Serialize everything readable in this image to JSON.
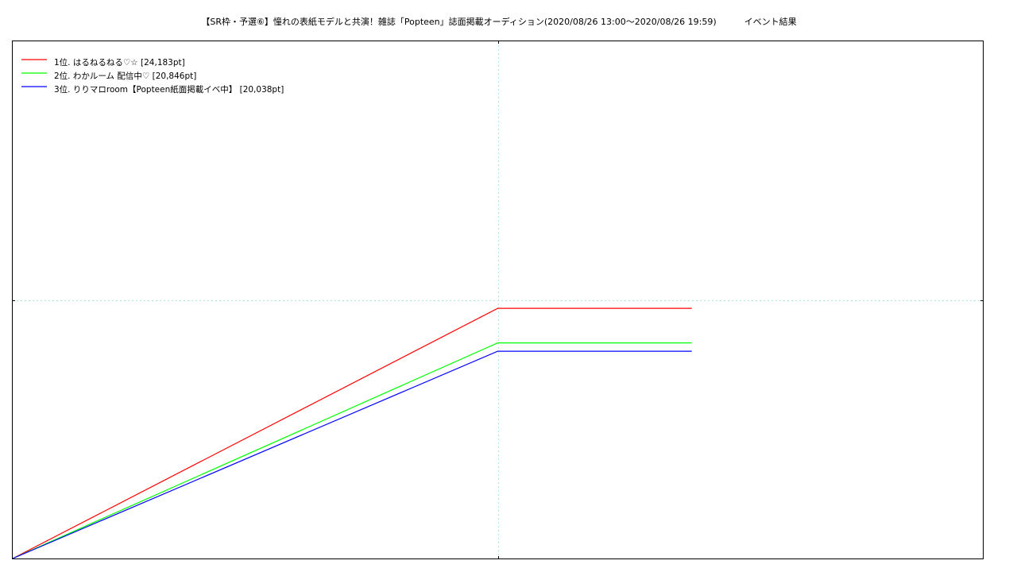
{
  "chart_data": {
    "type": "line",
    "title": "【SR枠・予選⑥】憧れの表紙モデルと共演！雑誌「Popteen」誌面掲載オーディション(2020/08/26 13:00〜2020/08/26 19:59)          イベント結果",
    "xlabel": "",
    "ylabel": "",
    "x": [
      0,
      1,
      1.4
    ],
    "xlim": [
      0,
      2
    ],
    "ylim": [
      0,
      50000
    ],
    "grid": true,
    "legend_position": "top-left",
    "series": [
      {
        "name": "1位. はるねるねる♡☆ [24,183pt]",
        "color": "#ff0000",
        "values": [
          0,
          24183,
          24183
        ]
      },
      {
        "name": "2位. わかルーム 配信中♡ [20,846pt]",
        "color": "#00ff00",
        "values": [
          0,
          20846,
          20846
        ]
      },
      {
        "name": "3位. りりマロroom【Popteen紙面掲載イベ中】 [20,038pt]",
        "color": "#0000ff",
        "values": [
          0,
          20038,
          20038
        ]
      }
    ]
  }
}
